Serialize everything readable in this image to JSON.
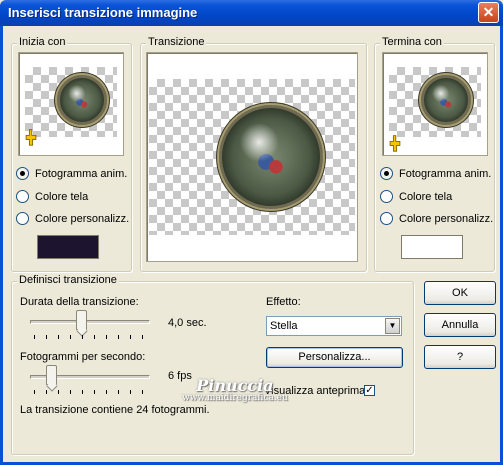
{
  "window": {
    "title": "Inserisci transizione immagine",
    "close_glyph": "✕"
  },
  "start_group": {
    "label": "Inizia con",
    "options": [
      "Fotogramma anim.",
      "Colore tela",
      "Colore personalizz."
    ],
    "selected_index": 0,
    "custom_color": "#1d1530"
  },
  "transition_group": {
    "label": "Transizione"
  },
  "end_group": {
    "label": "Termina con",
    "options": [
      "Fotogramma anim.",
      "Colore tela",
      "Colore personalizz."
    ],
    "selected_index": 0,
    "custom_color": "#ffffff"
  },
  "define_group": {
    "label": "Definisci transizione",
    "duration_label": "Durata della transizione:",
    "duration_value": "4,0 sec.",
    "duration_fraction": 0.43,
    "fps_label": "Fotogrammi per secondo:",
    "fps_value": "6 fps",
    "fps_fraction": 0.18,
    "summary": "La transizione contiene 24 fotogrammi.",
    "effect_label": "Effetto:",
    "effect_value": "Stella",
    "customize_button": "Personalizza...",
    "preview_label": "Visualizza anteprima",
    "preview_checked": true
  },
  "buttons": {
    "ok": "OK",
    "cancel": "Annulla",
    "help": "?"
  },
  "watermark": {
    "name": "Pinuccia",
    "site": "www.maidiregrafica.eu"
  },
  "icons": [
    "close-icon",
    "hand-pointer-icon",
    "dropdown-arrow-icon",
    "check-icon"
  ]
}
